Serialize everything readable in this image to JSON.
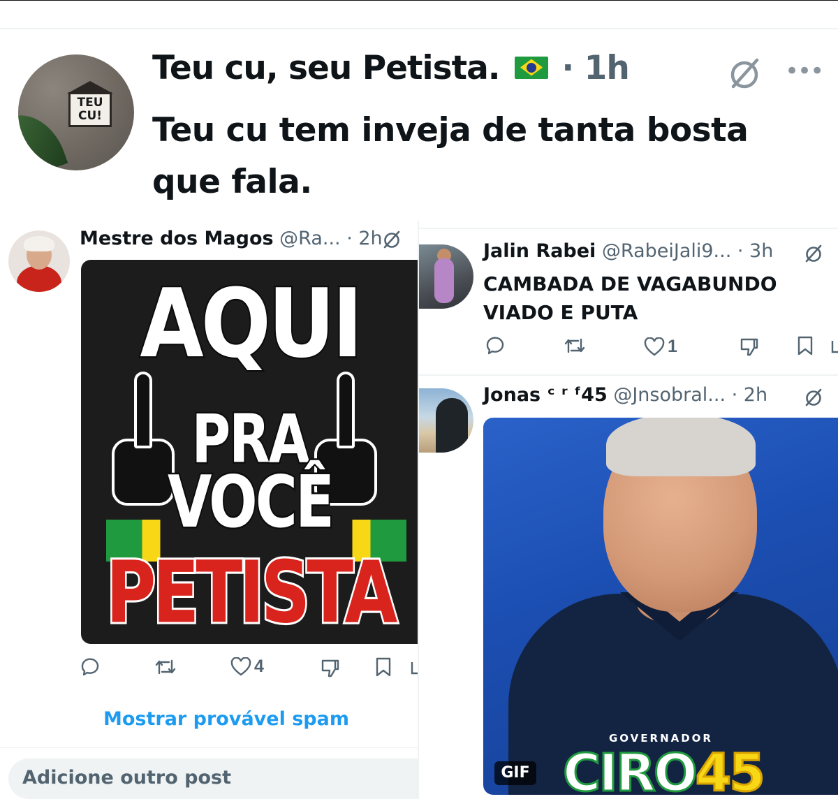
{
  "main_tweet": {
    "display_name": "Teu cu, seu Petista.",
    "separator": "·",
    "time": "1h",
    "text": "Teu cu tem inveja de tanta bosta que fala.",
    "avatar_text_line1": "TEU",
    "avatar_text_line2": "CU!",
    "more_label": "•••",
    "flag_icon": "brazil-flag-icon"
  },
  "left_reply": {
    "display_name": "Mestre dos Magos",
    "handle_time": "@Ra... · 2h",
    "meme": {
      "line1": "AQUI",
      "line2": "PRA",
      "line3": "VOCÊ",
      "line4": "PETISTA"
    },
    "likes": "4",
    "spam_link": "Mostrar provável spam",
    "add_post_placeholder": "Adicione outro post"
  },
  "right_reply_1": {
    "display_name": "Jalin Rabei",
    "handle_time": "@RabeiJali9... · 3h",
    "text": "CAMBADA DE VAGABUNDO\nVIADO E PUTA",
    "likes": "1"
  },
  "right_reply_2": {
    "display_name": "Jonas ᶜ ʳ ᶠ45",
    "handle_time": "@Jnsobral... · 2h",
    "gif_badge": "GIF",
    "image_caption_small": "GOVERNADOR",
    "image_caption_name": "CIRO",
    "image_caption_number": "45"
  },
  "colors": {
    "link_blue": "#1d9bf0",
    "secondary_text": "#536471",
    "primary_text": "#0f1419",
    "meme_red": "#d8241c",
    "brazil_green": "#1f9a3e",
    "brazil_yellow": "#f8d816"
  },
  "icons": [
    "reply-icon",
    "retweet-icon",
    "like-icon",
    "grok-icon",
    "bookmark-icon",
    "share-icon",
    "more-icon"
  ]
}
